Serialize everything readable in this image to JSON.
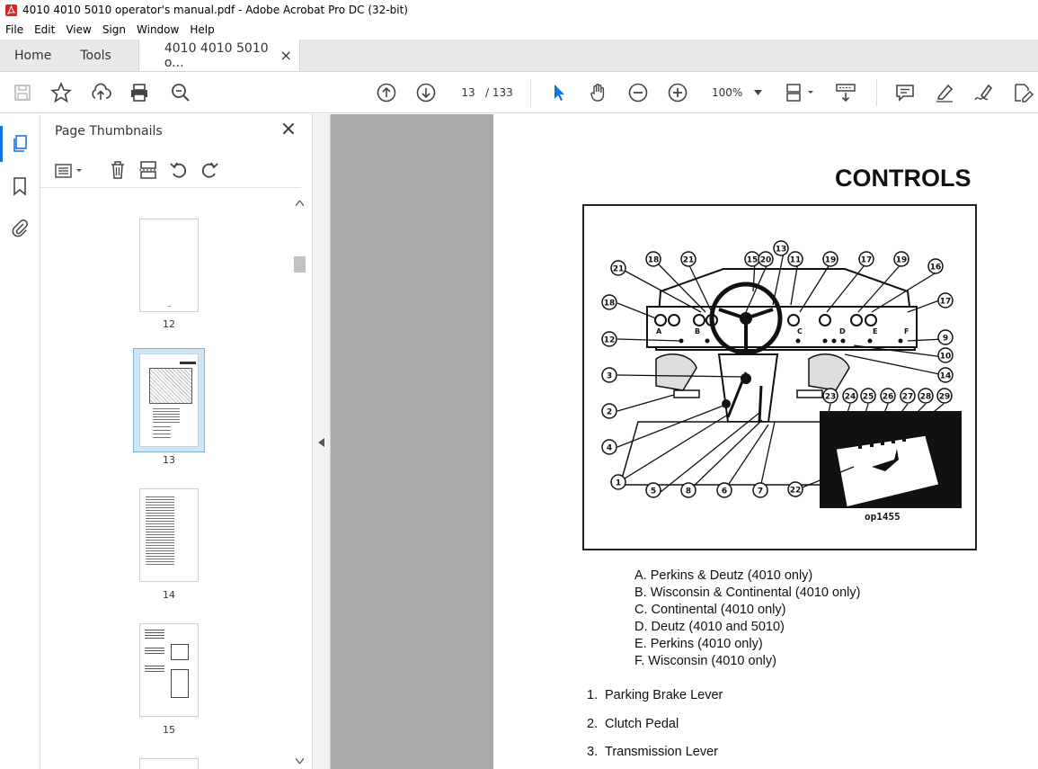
{
  "window": {
    "title": "4010 4010 5010 operator's manual.pdf - Adobe Acrobat Pro DC (32-bit)"
  },
  "menu": [
    "File",
    "Edit",
    "View",
    "Sign",
    "Window",
    "Help"
  ],
  "tabs": {
    "home": "Home",
    "tools": "Tools",
    "document": "4010 4010 5010 o...",
    "close": "×"
  },
  "toolbar": {
    "page_current": "13",
    "page_total": "/  133",
    "zoom": "100%",
    "icons": [
      "save-icon",
      "star-icon",
      "upload-icon",
      "print-icon",
      "search-zoom-icon",
      "prev-page-icon",
      "next-page-icon",
      "select-cursor-icon",
      "hand-icon",
      "zoom-out-icon",
      "zoom-in-icon",
      "fit-page-icon",
      "scroll-mode-icon",
      "comment-icon",
      "highlight-icon",
      "sign-icon",
      "edit-icon"
    ]
  },
  "panel": {
    "title": "Page Thumbnails",
    "close": "×",
    "thumbnails": [
      {
        "label": "12",
        "selected": false
      },
      {
        "label": "13",
        "selected": true
      },
      {
        "label": "14",
        "selected": false
      },
      {
        "label": "15",
        "selected": false
      }
    ]
  },
  "document": {
    "heading": "CONTROLS",
    "figure_code": "op1455",
    "callouts": [
      "21",
      "18",
      "21",
      "15",
      "20",
      "13",
      "11",
      "19",
      "17",
      "19",
      "16",
      "18",
      "17",
      "12",
      "9",
      "10",
      "3",
      "14",
      "2",
      "23",
      "24",
      "25",
      "26",
      "27",
      "28",
      "29",
      "4",
      "1",
      "5",
      "8",
      "6",
      "7",
      "22"
    ],
    "panel_letters": [
      "A",
      "B",
      "C",
      "D",
      "E",
      "F"
    ],
    "engine_types": [
      "A. Perkins & Deutz (4010 only)",
      "B. Wisconsin & Continental (4010 only)",
      "C. Continental (4010 only)",
      "D. Deutz (4010 and 5010)",
      "E. Perkins (4010 only)",
      "F. Wisconsin (4010 only)"
    ],
    "controls": [
      {
        "num": "1.",
        "label": "Parking Brake Lever"
      },
      {
        "num": "2.",
        "label": "Clutch Pedal"
      },
      {
        "num": "3.",
        "label": "Transmission Lever"
      }
    ]
  },
  "colors": {
    "viewer_bg": "#aaaaaa",
    "selected_thumb": "#cde6f7",
    "accent_blue": "#1473e6",
    "pdf_red": "#d7261e"
  }
}
